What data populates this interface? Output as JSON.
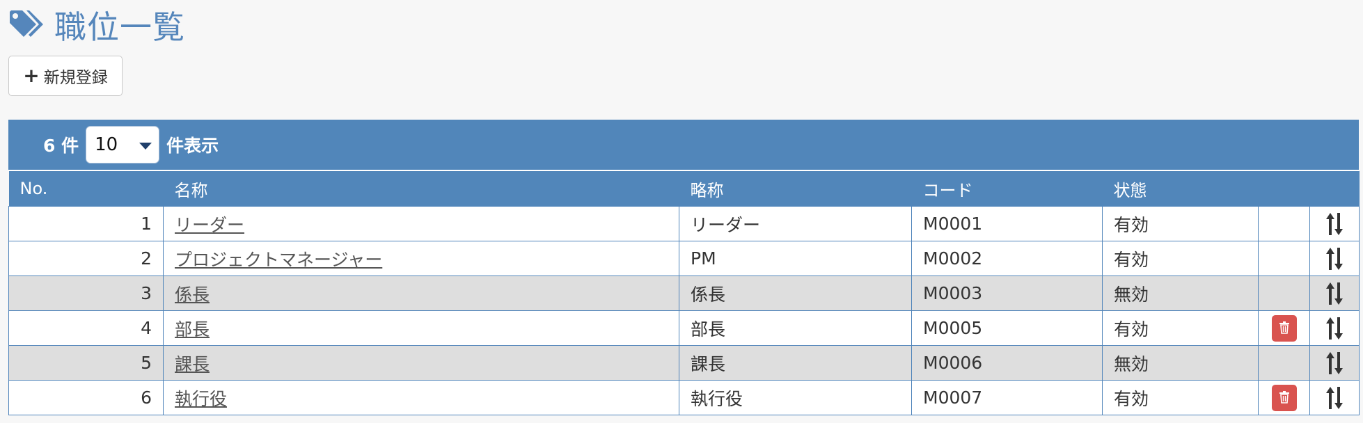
{
  "header": {
    "title": "職位一覧",
    "icon": "tags-icon"
  },
  "toolbar": {
    "new_label": "新規登録"
  },
  "grid": {
    "count_text": "6 件",
    "page_size": "10",
    "page_size_suffix": "件表示",
    "columns": {
      "no": "No.",
      "name": "名称",
      "short": "略称",
      "code": "コード",
      "status": "状態"
    },
    "rows": [
      {
        "no": "1",
        "name": "リーダー",
        "short": "リーダー",
        "code": "M0001",
        "status": "有効",
        "deletable": false
      },
      {
        "no": "2",
        "name": "プロジェクトマネージャー",
        "short": "PM",
        "code": "M0002",
        "status": "有効",
        "deletable": false
      },
      {
        "no": "3",
        "name": "係長",
        "short": "係長",
        "code": "M0003",
        "status": "無効",
        "deletable": false
      },
      {
        "no": "4",
        "name": "部長",
        "short": "部長",
        "code": "M0005",
        "status": "有効",
        "deletable": true
      },
      {
        "no": "5",
        "name": "課長",
        "short": "課長",
        "code": "M0006",
        "status": "無効",
        "deletable": false
      },
      {
        "no": "6",
        "name": "執行役",
        "short": "執行役",
        "code": "M0007",
        "status": "有効",
        "deletable": true
      }
    ]
  },
  "colors": {
    "accent": "#5186ba",
    "title": "#5586bb",
    "danger": "#d9534f",
    "disabled_row": "#dedede"
  }
}
